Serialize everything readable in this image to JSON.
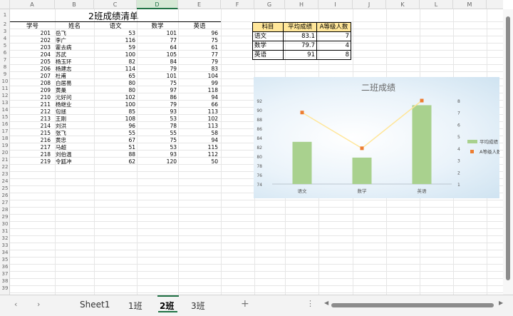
{
  "columns": [
    "A",
    "B",
    "C",
    "D",
    "E",
    "F",
    "G",
    "H",
    "I",
    "J",
    "K",
    "L",
    "M"
  ],
  "rows": [
    "1",
    "2",
    "3",
    "4",
    "5",
    "6",
    "7",
    "8",
    "9",
    "10",
    "11",
    "12",
    "13",
    "14",
    "15",
    "16",
    "17",
    "18",
    "19",
    "20",
    "21",
    "22",
    "23",
    "24",
    "25",
    "26",
    "27",
    "28",
    "29",
    "30",
    "31",
    "32",
    "33",
    "34",
    "35",
    "36",
    "37",
    "38",
    "39"
  ],
  "sheet_title": "2班成绩清单",
  "headers": [
    "学号",
    "姓名",
    "语文",
    "数学",
    "英语"
  ],
  "students": [
    [
      "201",
      "岳飞",
      "53",
      "101",
      "96"
    ],
    [
      "202",
      "李广",
      "116",
      "77",
      "75"
    ],
    [
      "203",
      "霍去病",
      "59",
      "64",
      "61"
    ],
    [
      "204",
      "苏武",
      "100",
      "105",
      "77"
    ],
    [
      "205",
      "杨玉环",
      "82",
      "84",
      "79"
    ],
    [
      "206",
      "杨建志",
      "114",
      "79",
      "83"
    ],
    [
      "207",
      "杜甫",
      "65",
      "101",
      "104"
    ],
    [
      "208",
      "白居易",
      "80",
      "75",
      "99"
    ],
    [
      "209",
      "黄巢",
      "80",
      "97",
      "118"
    ],
    [
      "210",
      "元好问",
      "102",
      "86",
      "94"
    ],
    [
      "211",
      "杨继业",
      "100",
      "79",
      "66"
    ],
    [
      "212",
      "包拯",
      "85",
      "93",
      "113"
    ],
    [
      "213",
      "王刚",
      "108",
      "53",
      "102"
    ],
    [
      "214",
      "刘洪",
      "96",
      "78",
      "113"
    ],
    [
      "215",
      "张飞",
      "55",
      "55",
      "58"
    ],
    [
      "216",
      "黄忠",
      "67",
      "75",
      "94"
    ],
    [
      "217",
      "马超",
      "51",
      "53",
      "115"
    ],
    [
      "218",
      "刘伯温",
      "88",
      "93",
      "112"
    ],
    [
      "219",
      "令狐冲",
      "62",
      "120",
      "50"
    ]
  ],
  "stats_table": {
    "headers": [
      "科目",
      "平均成绩",
      "A等级人数"
    ],
    "rows": [
      [
        "语文",
        "83.1",
        "7"
      ],
      [
        "数学",
        "79.7",
        "4"
      ],
      [
        "英语",
        "91",
        "8"
      ]
    ]
  },
  "chart_data": {
    "type": "bar",
    "title": "二班成绩",
    "categories": [
      "语文",
      "数学",
      "英语"
    ],
    "series": [
      {
        "name": "平均成绩",
        "kind": "bar",
        "axis": "left",
        "values": [
          83.1,
          79.7,
          91
        ],
        "color": "#a9d18e"
      },
      {
        "name": "A等级人数",
        "kind": "line",
        "axis": "right",
        "values": [
          7,
          4,
          8
        ],
        "color": "#ed7d31"
      }
    ],
    "y_left": {
      "min": 74,
      "max": 92,
      "ticks": [
        "74",
        "76",
        "78",
        "80",
        "82",
        "84",
        "86",
        "88",
        "90",
        "92"
      ]
    },
    "y_right": {
      "min": 1,
      "max": 8,
      "ticks": [
        "1",
        "2",
        "3",
        "4",
        "5",
        "6",
        "7",
        "8"
      ]
    },
    "legend_labels": [
      "平均成绩",
      "A等级人数"
    ],
    "legend_position": "right",
    "line_color": "#ffe699"
  },
  "tabs": [
    "Sheet1",
    "1班",
    "2班",
    "3班"
  ],
  "active_tab": "2班",
  "icons": {
    "prev": "chevron-left-icon",
    "next": "chevron-right-icon",
    "add": "plus-icon",
    "more": "more-vertical-icon"
  }
}
